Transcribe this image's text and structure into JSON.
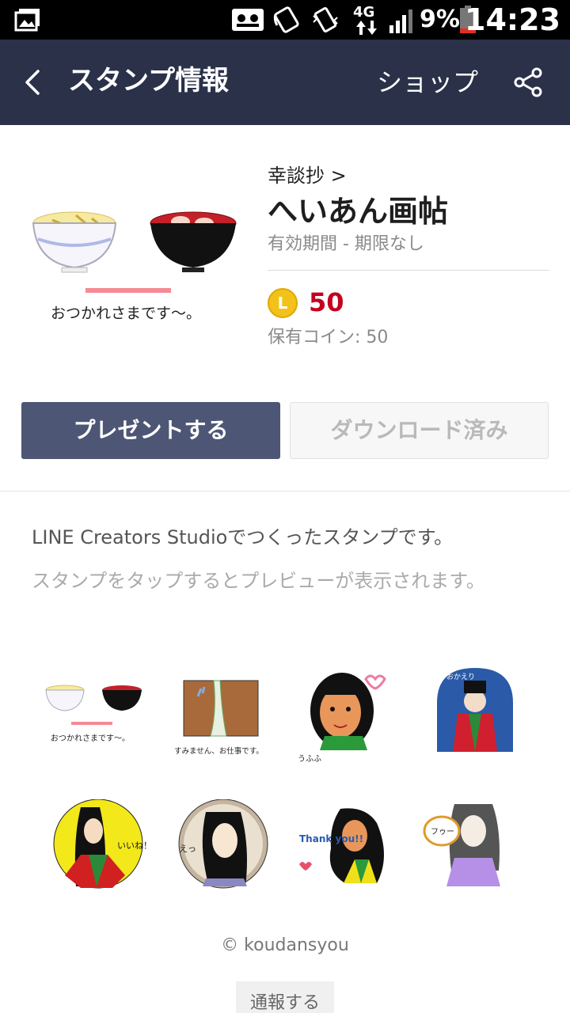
{
  "status_bar": {
    "battery_percent": "9%",
    "time": "14:23",
    "network": "4G"
  },
  "app_bar": {
    "title": "スタンプ情報",
    "shop_label": "ショップ"
  },
  "sticker_pack": {
    "author": "幸談抄 >",
    "title": "へいあん画帖",
    "validity": "有効期間 - 期限なし",
    "coin_symbol": "L",
    "price": "50",
    "coins_held": "保有コイン: 50",
    "main_sticker_caption": "おつかれさまです〜。"
  },
  "buttons": {
    "present": "プレゼントする",
    "downloaded": "ダウンロード済み"
  },
  "description": {
    "line1": "LINE Creators Studioでつくったスタンプです。",
    "line2": "スタンプをタップするとプレビューが表示されます。"
  },
  "stickers": [
    {
      "name": "noodle-soup-sticker",
      "caption": "おつかれさまです〜。"
    },
    {
      "name": "curtain-sticker",
      "caption": "すみません、お仕事です。"
    },
    {
      "name": "ufufu-sticker",
      "caption": "うふふ"
    },
    {
      "name": "okaeri-sticker",
      "caption": "おかえり"
    },
    {
      "name": "iine-sticker",
      "caption": "いいね！"
    },
    {
      "name": "e-sticker",
      "caption": "えっ"
    },
    {
      "name": "thank-you-sticker",
      "caption": "Thank you!!"
    },
    {
      "name": "fuu-sticker",
      "caption": "フゥー"
    }
  ],
  "footer": {
    "copyright": "© koudansyou",
    "report_label": "通報する"
  },
  "colors": {
    "app_bar": "#2a3149",
    "present_button": "#4e5675",
    "price": "#c4001e",
    "coin": "#f2c21b"
  }
}
